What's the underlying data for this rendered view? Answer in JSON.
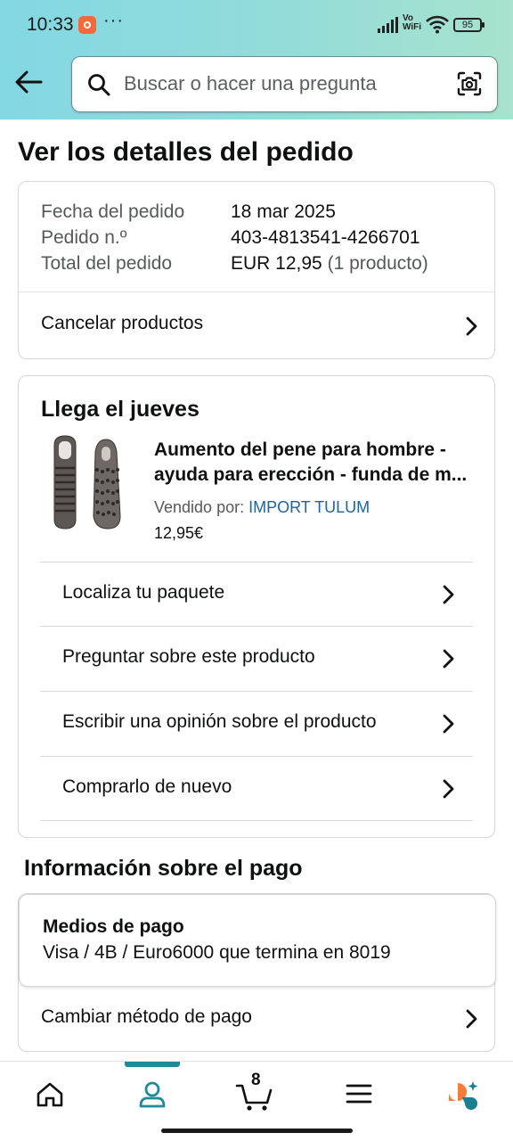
{
  "status_bar": {
    "time": "10:33",
    "more": "···",
    "network_label_1": "Vo",
    "network_label_2": "WiFi",
    "battery": "95"
  },
  "header": {
    "search_placeholder": "Buscar o hacer una pregunta",
    "back_icon": "arrow-left-icon",
    "camera_icon": "camera-scan-icon"
  },
  "page": {
    "title": "Ver los detalles del pedido"
  },
  "order_summary": {
    "rows": [
      {
        "label": "Fecha del pedido",
        "value": "18 mar 2025"
      },
      {
        "label": "Pedido n.º",
        "value": "403-4813541-4266701"
      },
      {
        "label": "Total del pedido",
        "value": "EUR 12,95",
        "extra": "(1 producto)"
      }
    ],
    "cancel_label": "Cancelar productos"
  },
  "shipment": {
    "heading": "Llega el jueves",
    "product": {
      "title_line1": "Aumento del pene para hombre -",
      "title_line2": "ayuda para erección - funda de m...",
      "sold_by_label": "Vendido por:",
      "seller": "IMPORT TULUM",
      "price": "12,95€"
    },
    "actions": [
      {
        "label": "Localiza tu paquete"
      },
      {
        "label": "Preguntar sobre este producto"
      },
      {
        "label": "Escribir una opinión sobre el producto"
      },
      {
        "label": "Comprarlo de nuevo"
      }
    ]
  },
  "payment": {
    "section_title": "Información sobre el pago",
    "methods_heading": "Medios de pago",
    "methods_value": "Visa / 4B / Euro6000  que termina en 8019",
    "change_label": "Cambiar método de pago"
  },
  "bottom_nav": {
    "items": [
      "home-icon",
      "account-icon",
      "cart-icon",
      "menu-icon",
      "rufus-assistant-icon"
    ],
    "active": "account-icon",
    "cart_count": "8"
  },
  "colors": {
    "header_gradient_start": "#82d8e3",
    "header_gradient_end": "#a7e3cd",
    "link": "#2162a1",
    "active_tab": "#1f8a9a"
  }
}
